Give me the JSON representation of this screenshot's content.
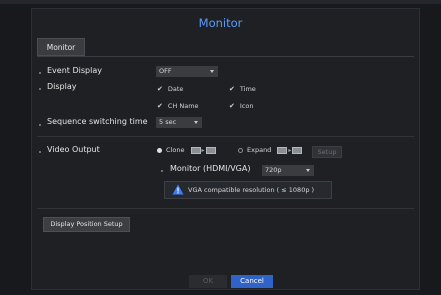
{
  "window": {
    "title": "Monitor"
  },
  "tabs": [
    {
      "label": "Monitor"
    }
  ],
  "settings": {
    "event_display": {
      "label": "Event Display",
      "value": "OFF"
    },
    "display": {
      "label": "Display",
      "options": [
        {
          "label": "Date",
          "checked": true
        },
        {
          "label": "Time",
          "checked": true
        },
        {
          "label": "CH Name",
          "checked": true
        },
        {
          "label": "Icon",
          "checked": true
        }
      ]
    },
    "sequence": {
      "label": "Sequence switching time",
      "value": "5 sec"
    },
    "video_output": {
      "label": "Video Output",
      "clone_label": "Clone",
      "expand_label": "Expand",
      "selected": "Clone",
      "setup_label": "Setup",
      "monitor_label": "Monitor (HDMI/VGA)",
      "monitor_value": "720p",
      "warning": "VGA compatible resolution ( ≤ 1080p )"
    },
    "display_position_label": "Display Position Setup"
  },
  "footer": {
    "ok_label": "OK",
    "cancel_label": "Cancel"
  },
  "colors": {
    "accent": "#5a9bff",
    "cancel": "#2f63c8",
    "warning": "#3d7bff"
  }
}
